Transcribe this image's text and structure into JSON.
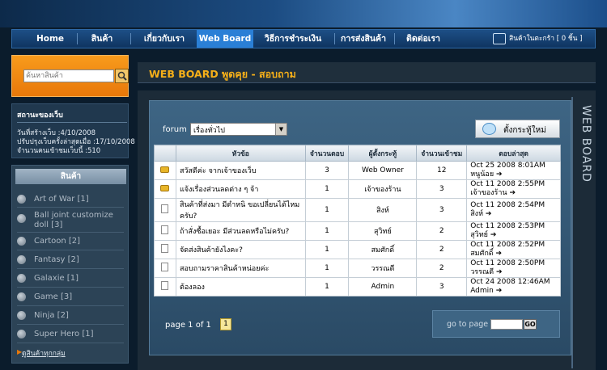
{
  "nav": {
    "items": [
      "Home",
      "สินค้า",
      "เกี่ยวกับเรา",
      "Web Board",
      "วิธีการชำระเงิน",
      "การส่งสินค้า",
      "ติดต่อเรา"
    ],
    "active": "Web Board",
    "cart": "สินค้าในตะกร้า [ 0 ชิ้น ]"
  },
  "search": {
    "placeholder": "ค้นหาสินค้า"
  },
  "status": {
    "title": "สถานะของเว็บ",
    "created": "วันที่สร้างเว็บ :4/10/2008",
    "updated": "ปรับปรุงเว็บครั้งล่าสุดเมื่อ :17/10/2008",
    "visitors": "จำนวนคนเข้าชมเว็บนี้ :510"
  },
  "categories": {
    "title": "สินค้า",
    "items": [
      "Art of War [1]",
      "Ball joint customize doll [3]",
      "Cartoon [2]",
      "Fantasy [2]",
      "Galaxie [1]",
      "Game [3]",
      "Ninja [2]",
      "Super Hero [1]"
    ],
    "all_link": "ดูสินค้าทุกกลุ่ม"
  },
  "main": {
    "title": "WEB BOARD พูดคุย - สอบถาม",
    "side_label": "WEB BOARD",
    "forum_label": "forum :",
    "forum_selected": "เรื่องทั่วไป",
    "new_topic": "ตั้งกระทู้ใหม่"
  },
  "table": {
    "headers": [
      "หัวข้อ",
      "จำนวนตอบ",
      "ผู้ตั้งกระทู้",
      "จำนวนเข้าชม",
      "ตอบล่าสุด"
    ],
    "rows": [
      {
        "icon": "folder",
        "topic": "สวัสดีค่ะ จากเจ้าของเว็บ",
        "replies": "3",
        "author": "Web Owner",
        "views": "12",
        "last_date": "Oct 25 2008 8:01AM",
        "last_user": "หนูน้อย"
      },
      {
        "icon": "folder",
        "topic": "แจ้งเรื่องส่วนลดต่าง ๆ จ้า",
        "replies": "1",
        "author": "เจ้าของร้าน",
        "views": "3",
        "last_date": "Oct 11 2008 2:55PM",
        "last_user": "เจ้าของร้าน"
      },
      {
        "icon": "doc",
        "topic": "สินค้าที่ส่งมา มีตำหนิ ขอเปลี่ยนได้ไหมครับ?",
        "replies": "1",
        "author": "สิงห์",
        "views": "3",
        "last_date": "Oct 11 2008 2:54PM",
        "last_user": "สิงห์"
      },
      {
        "icon": "doc",
        "topic": "ถ้าสั่งซื้อเยอะ มีส่วนลดหรือไม่ครับ?",
        "replies": "1",
        "author": "สุวิทย์",
        "views": "2",
        "last_date": "Oct 11 2008 2:53PM",
        "last_user": "สุวิทย์"
      },
      {
        "icon": "doc",
        "topic": "จัดส่งสินค้ายังไงคะ?",
        "replies": "1",
        "author": "สมศักดิ์",
        "views": "2",
        "last_date": "Oct 11 2008 2:52PM",
        "last_user": "สมศักดิ์"
      },
      {
        "icon": "doc",
        "topic": "สอบถามราคาสินค้าหน่อยค่ะ",
        "replies": "1",
        "author": "วรรณดี",
        "views": "2",
        "last_date": "Oct 11 2008 2:50PM",
        "last_user": "วรรณดี"
      },
      {
        "icon": "doc",
        "topic": "ต้องลอง",
        "replies": "1",
        "author": "Admin",
        "views": "3",
        "last_date": "Oct 24 2008 12:46AM",
        "last_user": "Admin"
      }
    ]
  },
  "pager": {
    "info": "page 1 of 1",
    "current": "1",
    "goto_label": "go to page",
    "go": "GO"
  }
}
